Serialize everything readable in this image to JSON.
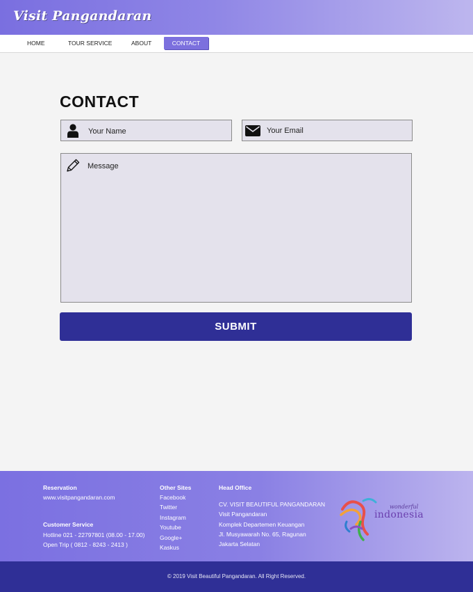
{
  "brand": {
    "logo_text": "Visit Pangandaran"
  },
  "nav": {
    "items": [
      {
        "label": "HOME"
      },
      {
        "label": "TOUR SERVICE"
      },
      {
        "label": "ABOUT"
      },
      {
        "label": "CONTACT",
        "active": true
      }
    ]
  },
  "contact": {
    "title": "CONTACT",
    "name_placeholder": "Your Name",
    "email_placeholder": "Your Email",
    "message_placeholder": "Message",
    "submit_label": "SUBMIT"
  },
  "footer": {
    "reservation": {
      "heading": "Reservation",
      "website": "www.visitpangandaran.com"
    },
    "customer_service": {
      "heading": "Customer Service",
      "hotline": "Hotline 021 - 22797801 (08.00 - 17.00)",
      "open_trip": "Open Trip ( 0812 - 8243 - 2413 )"
    },
    "other_sites": {
      "heading": "Other Sites",
      "links": [
        "Facebook",
        "Twitter",
        "Instagram",
        "Youtube",
        "Google+",
        "Kaskus"
      ]
    },
    "head_office": {
      "heading": "Head Office",
      "lines": [
        "CV. VISIT BEAUTIFUL PANGANDARAN",
        "Visit Pangandaran",
        "Komplek Departemen Keuangan",
        "Jl. Musyawarah No. 65, Ragunan",
        "Jakarta Selatan"
      ]
    },
    "partner_logo": {
      "line1": "wonderful",
      "line2": "indonesia"
    },
    "copyright": "© 2019 Visit Beautiful Pangandaran. All Right Reserved."
  },
  "colors": {
    "header_start": "#7a6fe0",
    "header_end": "#bdb6ee",
    "accent": "#7c70de",
    "submit_bg": "#2f2f96",
    "field_bg": "#e4e2ec",
    "page_bg": "#f4f4f4"
  }
}
